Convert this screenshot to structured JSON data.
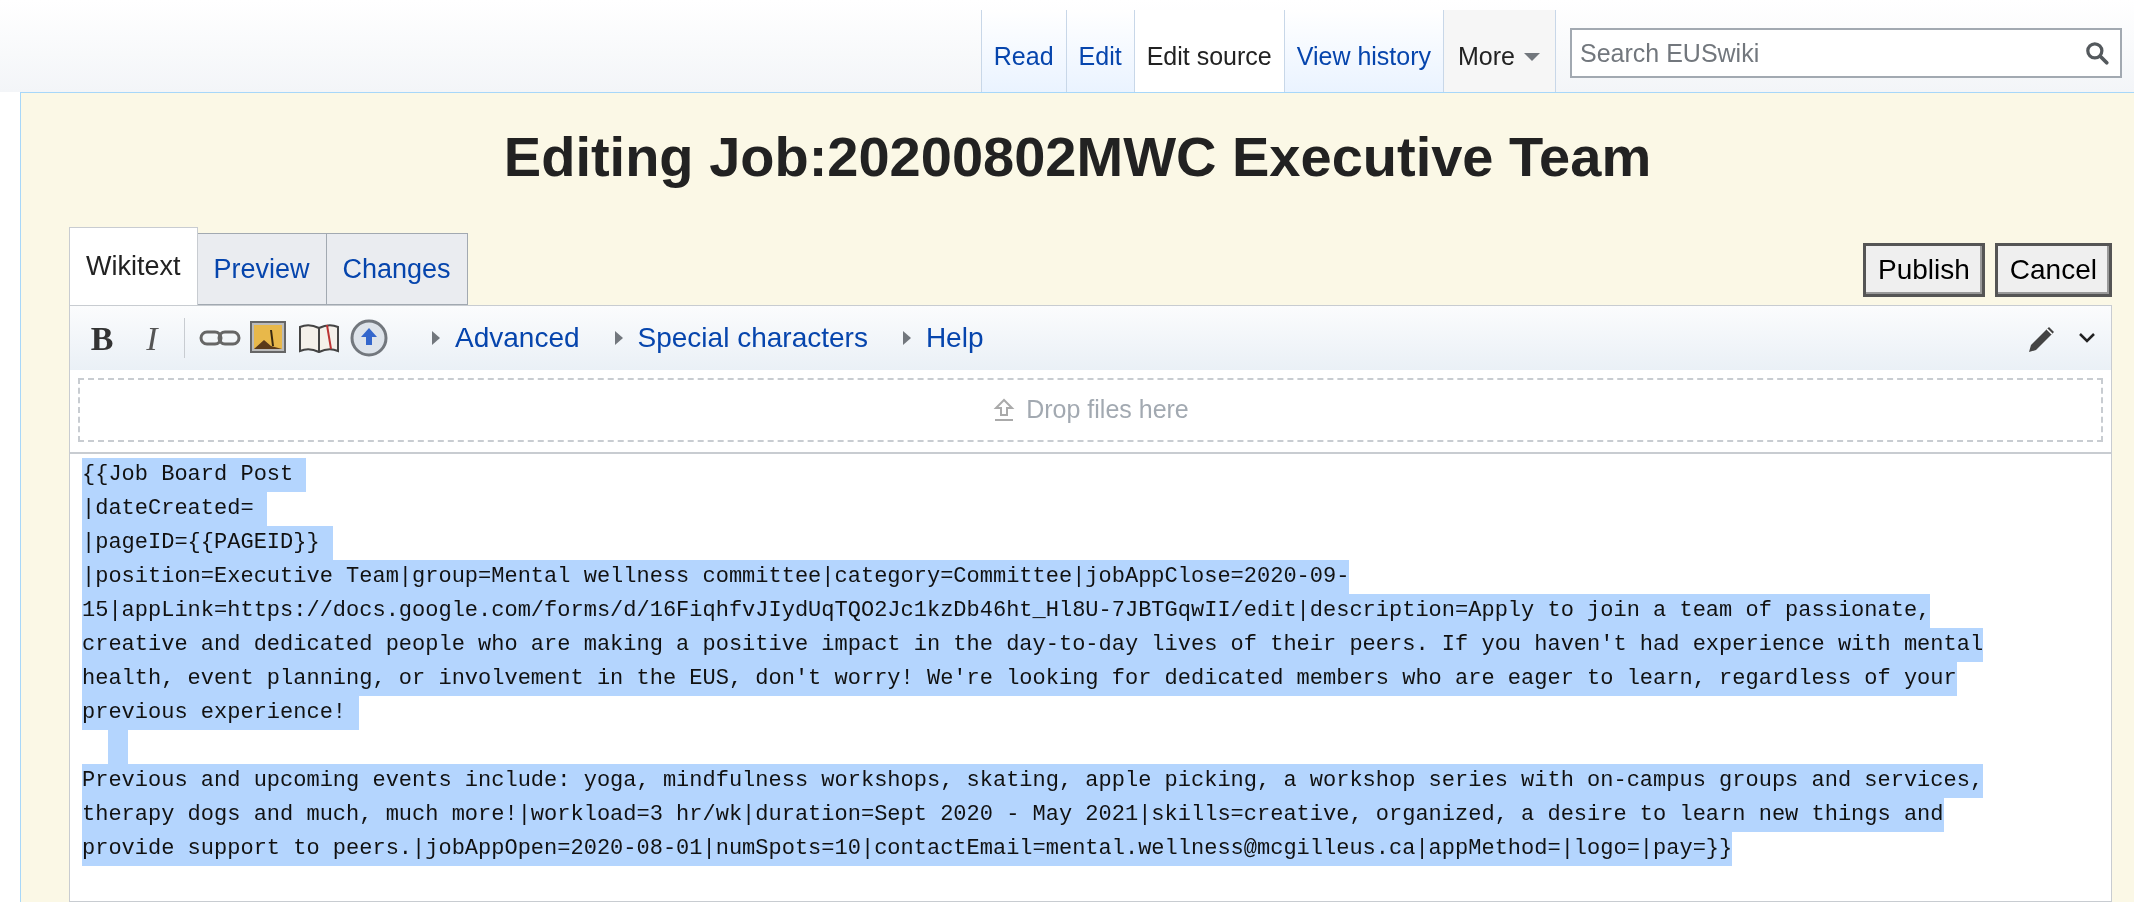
{
  "view_tabs": [
    {
      "label": "Read",
      "selected": false
    },
    {
      "label": "Edit",
      "selected": false
    },
    {
      "label": "Edit source",
      "selected": true
    },
    {
      "label": "View history",
      "selected": false
    }
  ],
  "more_menu": {
    "label": "More"
  },
  "search": {
    "placeholder": "Search EUSwiki"
  },
  "page_title": "Editing Job:20200802MWC Executive Team",
  "editor_tabs": [
    {
      "label": "Wikitext",
      "selected": true
    },
    {
      "label": "Preview",
      "selected": false
    },
    {
      "label": "Changes",
      "selected": false
    }
  ],
  "buttons": [
    "Publish",
    "Cancel"
  ],
  "toolbar": {
    "bold": "B",
    "italic": "I",
    "sections": [
      "Advanced",
      "Special characters",
      "Help"
    ]
  },
  "drop_zone": "Drop files here",
  "source": {
    "selected": true,
    "lines": [
      {
        "kind": "text",
        "text": "{{Job Board Post "
      },
      {
        "kind": "text",
        "text": "|dateCreated= "
      },
      {
        "kind": "text",
        "text": "|pageID={{PAGEID}} "
      },
      {
        "kind": "text",
        "text": "|position=Executive Team|group=Mental wellness committee|category=Committee|jobAppClose=2020-09-"
      },
      {
        "kind": "text",
        "text": "15|appLink=https://docs.google.com/forms/d/16FiqhfvJIydUqTQO2Jc1kzDb46ht_Hl8U-7JBTGqwII/edit|description=Apply to join a team of passionate,"
      },
      {
        "kind": "text",
        "text": "creative and dedicated people who are making a positive impact in the day-to-day lives of their peers. If you haven't had experience with mental"
      },
      {
        "kind": "text",
        "text": "health, event planning, or involvement in the EUS, don't worry! We're looking for dedicated members who are eager to learn, regardless of your"
      },
      {
        "kind": "text",
        "text": "previous experience! "
      },
      {
        "kind": "blank"
      },
      {
        "kind": "text",
        "text": "Previous and upcoming events include: yoga, mindfulness workshops, skating, apple picking, a workshop series with on-campus groups and services,"
      },
      {
        "kind": "text",
        "text": "therapy dogs and much, much more!|workload=3 hr/wk|duration=Sept 2020 - May 2021|skills=creative, organized, a desire to learn new things and"
      },
      {
        "kind": "text",
        "text": "provide support to peers.|jobAppOpen=2020-08-01|numSpots=10|contactEmail=mental.wellness@mcgilleus.ca|appMethod=|logo=|pay=}}"
      }
    ]
  }
}
